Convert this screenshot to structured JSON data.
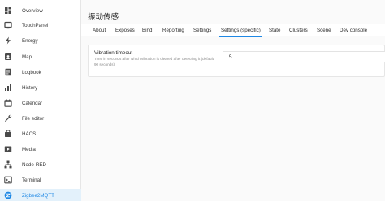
{
  "sidebar": {
    "items": [
      {
        "label": "Overview",
        "icon": "dashboard-icon"
      },
      {
        "label": "TouchPanel",
        "icon": "touch-panel-icon"
      },
      {
        "label": "Energy",
        "icon": "lightning-icon"
      },
      {
        "label": "Map",
        "icon": "map-icon"
      },
      {
        "label": "Logbook",
        "icon": "logbook-icon"
      },
      {
        "label": "History",
        "icon": "history-icon"
      },
      {
        "label": "Calendar",
        "icon": "calendar-icon"
      },
      {
        "label": "File editor",
        "icon": "wrench-icon"
      },
      {
        "label": "HACS",
        "icon": "hacs-icon"
      },
      {
        "label": "Media",
        "icon": "media-icon"
      },
      {
        "label": "Node-RED",
        "icon": "node-red-icon"
      },
      {
        "label": "Terminal",
        "icon": "terminal-icon"
      },
      {
        "label": "Zigbee2MQTT",
        "icon": "zigbee-icon",
        "active": true
      }
    ]
  },
  "header": {
    "title": "振动传感"
  },
  "tabs": [
    {
      "label": "About"
    },
    {
      "label": "Exposes"
    },
    {
      "label": "Bind"
    },
    {
      "label": "Reporting"
    },
    {
      "label": "Settings"
    },
    {
      "label": "Settings (specific)",
      "active": true
    },
    {
      "label": "State"
    },
    {
      "label": "Clusters"
    },
    {
      "label": "Scene"
    },
    {
      "label": "Dev console"
    }
  ],
  "settings": {
    "vibration_timeout": {
      "label": "Vibration timeout",
      "help": "Time in seconds after which vibration is cleared after detecting it (default 90 seconds).",
      "value": "5"
    }
  },
  "colors": {
    "accent": "#1e88e5",
    "sidebar_icon": "#4a4a4a",
    "active_bg": "#e3f1fb"
  }
}
